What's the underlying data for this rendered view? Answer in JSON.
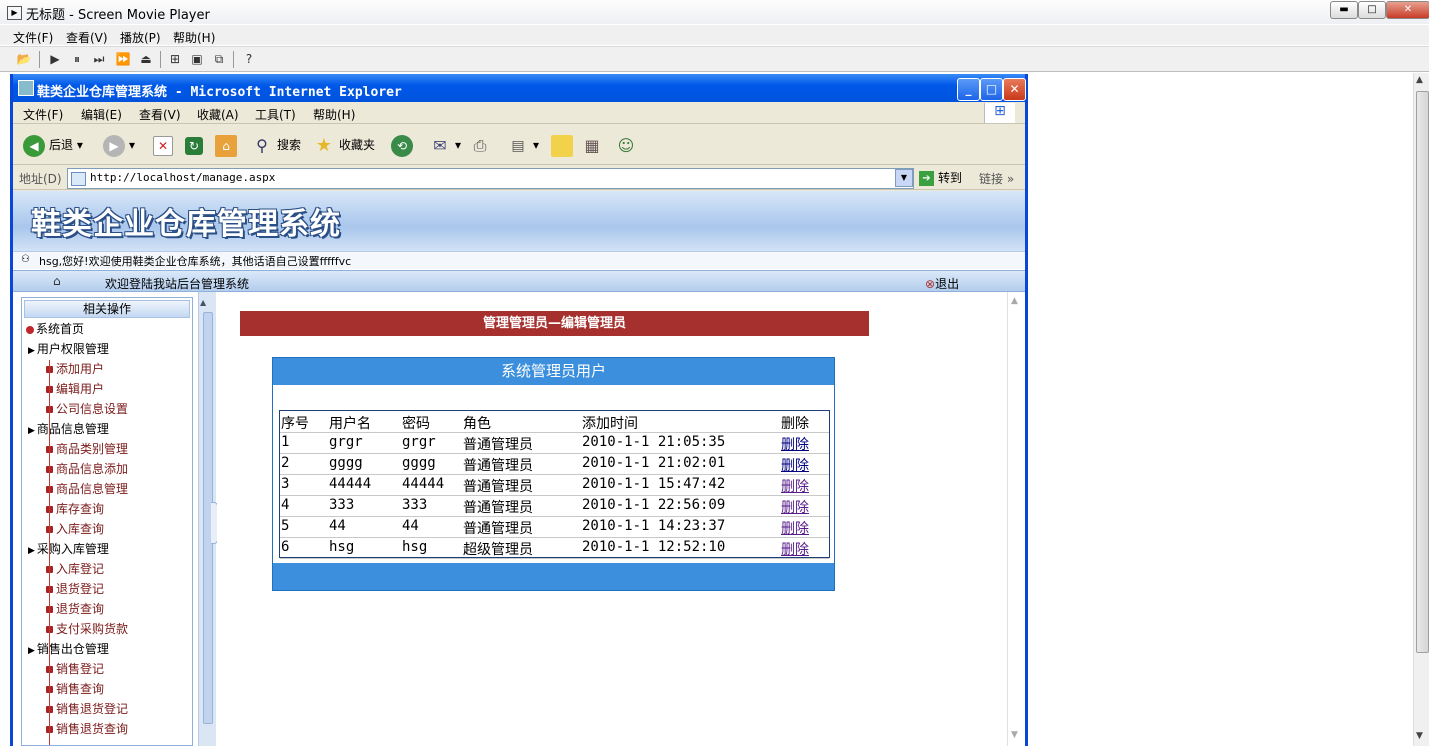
{
  "outer": {
    "title": "无标题 - Screen Movie Player",
    "menu": [
      "文件(F)",
      "查看(V)",
      "播放(P)",
      "帮助(H)"
    ]
  },
  "ie": {
    "title": "鞋类企业仓库管理系统 - Microsoft Internet Explorer",
    "menu": [
      "文件(F)",
      "编辑(E)",
      "查看(V)",
      "收藏(A)",
      "工具(T)",
      "帮助(H)"
    ],
    "toolbar": {
      "back": "后退",
      "search": "搜索",
      "favorites": "收藏夹"
    },
    "address": {
      "label": "地址(D)",
      "url": "http://localhost/manage.aspx",
      "go": "转到",
      "links": "链接"
    }
  },
  "site": {
    "banner": "鞋类企业仓库管理系统",
    "welcome": "hsg,您好!欢迎使用鞋类企业仓库系统，其他话语自己设置fffffvc",
    "nav_text": "欢迎登陆我站后台管理系统",
    "logout": "退出",
    "sidebar_title": "相关操作",
    "tree": [
      {
        "label": "系统首页",
        "level": 0
      },
      {
        "label": "用户权限管理",
        "level": 1
      },
      {
        "label": "添加用户",
        "level": 2
      },
      {
        "label": "编辑用户",
        "level": 2
      },
      {
        "label": "公司信息设置",
        "level": 2
      },
      {
        "label": "商品信息管理",
        "level": 1
      },
      {
        "label": "商品类别管理",
        "level": 2
      },
      {
        "label": "商品信息添加",
        "level": 2
      },
      {
        "label": "商品信息管理",
        "level": 2
      },
      {
        "label": "库存查询",
        "level": 2
      },
      {
        "label": "入库查询",
        "level": 2
      },
      {
        "label": "采购入库管理",
        "level": 1
      },
      {
        "label": "入库登记",
        "level": 2
      },
      {
        "label": "退货登记",
        "level": 2
      },
      {
        "label": "退货查询",
        "level": 2
      },
      {
        "label": "支付采购货款",
        "level": 2
      },
      {
        "label": "销售出仓管理",
        "level": 1
      },
      {
        "label": "销售登记",
        "level": 2
      },
      {
        "label": "销售查询",
        "level": 2
      },
      {
        "label": "销售退货登记",
        "level": 2
      },
      {
        "label": "销售退货查询",
        "level": 2
      }
    ],
    "edit_title": "管理管理员—编辑管理员",
    "card_title": "系统管理员用户",
    "table": {
      "headers": [
        "序号",
        "用户名",
        "密码",
        "角色",
        "添加时间",
        "删除"
      ],
      "rows": [
        [
          "1",
          "grgr",
          "grgr",
          "普通管理员",
          "2010-1-1  21:05:35",
          "删除"
        ],
        [
          "2",
          "gggg",
          "gggg",
          "普通管理员",
          "2010-1-1  21:02:01",
          "删除"
        ],
        [
          "3",
          "44444",
          "44444",
          "普通管理员",
          "2010-1-1  15:47:42",
          "删除"
        ],
        [
          "4",
          "333",
          "333",
          "普通管理员",
          "2010-1-1  22:56:09",
          "删除"
        ],
        [
          "5",
          "44",
          "44",
          "普通管理员",
          "2010-1-1  14:23:37",
          "删除"
        ],
        [
          "6",
          "hsg",
          "hsg",
          "超级管理员",
          "2010-1-1  12:52:10",
          "删除"
        ]
      ]
    }
  }
}
